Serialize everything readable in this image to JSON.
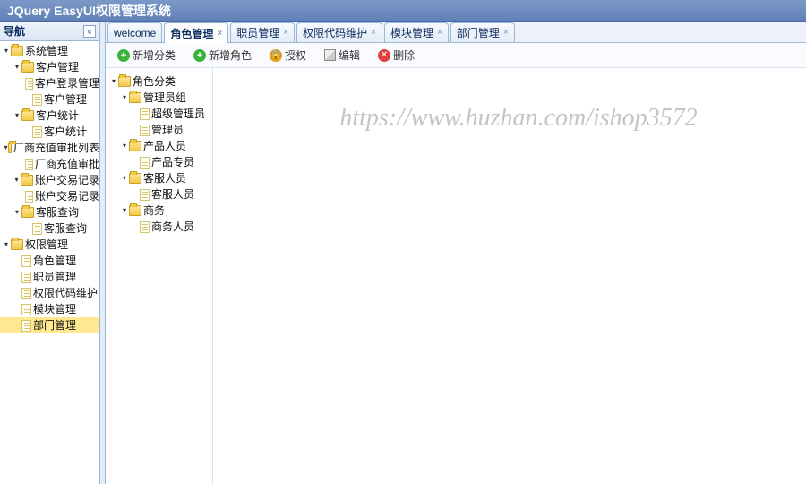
{
  "app_title": "JQuery EasyUI权限管理系统",
  "west": {
    "title": "导航",
    "tree": [
      {
        "depth": 0,
        "hit": "▾",
        "kind": "folder",
        "label": "系统管理"
      },
      {
        "depth": 1,
        "hit": "▾",
        "kind": "folder",
        "label": "客户管理"
      },
      {
        "depth": 2,
        "hit": "",
        "kind": "file",
        "label": "客户登录管理"
      },
      {
        "depth": 2,
        "hit": "",
        "kind": "file",
        "label": "客户管理"
      },
      {
        "depth": 1,
        "hit": "▾",
        "kind": "folder",
        "label": "客户统计"
      },
      {
        "depth": 2,
        "hit": "",
        "kind": "file",
        "label": "客户统计"
      },
      {
        "depth": 1,
        "hit": "▾",
        "kind": "folder",
        "label": "厂商充值审批列表"
      },
      {
        "depth": 2,
        "hit": "",
        "kind": "file",
        "label": "厂商充值审批"
      },
      {
        "depth": 1,
        "hit": "▾",
        "kind": "folder",
        "label": "账户交易记录"
      },
      {
        "depth": 2,
        "hit": "",
        "kind": "file",
        "label": "账户交易记录"
      },
      {
        "depth": 1,
        "hit": "▾",
        "kind": "folder",
        "label": "客服查询"
      },
      {
        "depth": 2,
        "hit": "",
        "kind": "file",
        "label": "客服查询"
      },
      {
        "depth": 0,
        "hit": "▾",
        "kind": "folder",
        "label": "权限管理"
      },
      {
        "depth": 1,
        "hit": "",
        "kind": "file",
        "label": "角色管理"
      },
      {
        "depth": 1,
        "hit": "",
        "kind": "file",
        "label": "职员管理"
      },
      {
        "depth": 1,
        "hit": "",
        "kind": "file",
        "label": "权限代码维护"
      },
      {
        "depth": 1,
        "hit": "",
        "kind": "file",
        "label": "模块管理"
      },
      {
        "depth": 1,
        "hit": "",
        "kind": "file",
        "label": "部门管理",
        "selected": true
      }
    ]
  },
  "tabs": [
    {
      "label": "welcome",
      "closable": false
    },
    {
      "label": "角色管理",
      "closable": true,
      "active": true
    },
    {
      "label": "职员管理",
      "closable": true
    },
    {
      "label": "权限代码维护",
      "closable": true
    },
    {
      "label": "模块管理",
      "closable": true
    },
    {
      "label": "部门管理",
      "closable": true
    }
  ],
  "toolbar": {
    "new_category": "新增分类",
    "new_role": "新增角色",
    "authorize": "授权",
    "edit": "编辑",
    "delete": "删除"
  },
  "inner_tree": [
    {
      "depth": 0,
      "hit": "▾",
      "kind": "folder",
      "label": "角色分类"
    },
    {
      "depth": 1,
      "hit": "▾",
      "kind": "folder",
      "label": "管理员组"
    },
    {
      "depth": 2,
      "hit": "",
      "kind": "file",
      "label": "超级管理员"
    },
    {
      "depth": 2,
      "hit": "",
      "kind": "file",
      "label": "管理员"
    },
    {
      "depth": 1,
      "hit": "▾",
      "kind": "folder",
      "label": "产品人员"
    },
    {
      "depth": 2,
      "hit": "",
      "kind": "file",
      "label": "产品专员"
    },
    {
      "depth": 1,
      "hit": "▾",
      "kind": "folder",
      "label": "客服人员"
    },
    {
      "depth": 2,
      "hit": "",
      "kind": "file",
      "label": "客服人员"
    },
    {
      "depth": 1,
      "hit": "▾",
      "kind": "folder",
      "label": "商务"
    },
    {
      "depth": 2,
      "hit": "",
      "kind": "file",
      "label": "商务人员"
    }
  ],
  "watermark": "https://www.huzhan.com/ishop3572"
}
